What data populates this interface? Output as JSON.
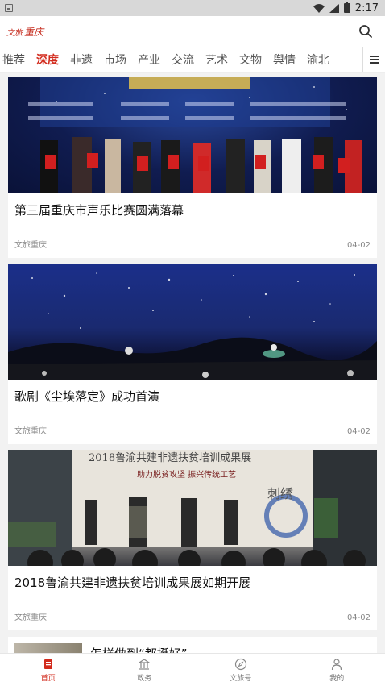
{
  "status_bar": {
    "time": "2:17"
  },
  "header": {
    "logo_text": "重庆",
    "logo_prefix": "文旅"
  },
  "tabs": [
    "推荐",
    "深度",
    "非遗",
    "市场",
    "产业",
    "交流",
    "艺术",
    "文物",
    "舆情",
    "渝北"
  ],
  "active_tab_index": 1,
  "articles": [
    {
      "title": "第三届重庆市声乐比赛圆满落幕",
      "source": "文旅重庆",
      "date": "04-02"
    },
    {
      "title": "歌剧《尘埃落定》成功首演",
      "source": "文旅重庆",
      "date": "04-02"
    },
    {
      "title": "2018鲁渝共建非遗扶贫培训成果展如期开展",
      "source": "文旅重庆",
      "date": "04-02"
    },
    {
      "title": "怎样做到“都挺好”",
      "source": "",
      "date": ""
    }
  ],
  "image_texts": {
    "banner_title": "2018鲁渝共建非遗扶贫培训成果展",
    "banner_subtitle": "助力脱贫攻坚  振兴传统工艺",
    "banner_art": "刺绣"
  },
  "bottom_nav": [
    {
      "label": "首页",
      "icon": "home-icon"
    },
    {
      "label": "政务",
      "icon": "government-building-icon"
    },
    {
      "label": "文旅号",
      "icon": "compass-icon"
    },
    {
      "label": "我的",
      "icon": "user-icon"
    }
  ],
  "colors": {
    "accent": "#d22a1c",
    "background": "#f2f2f2"
  }
}
